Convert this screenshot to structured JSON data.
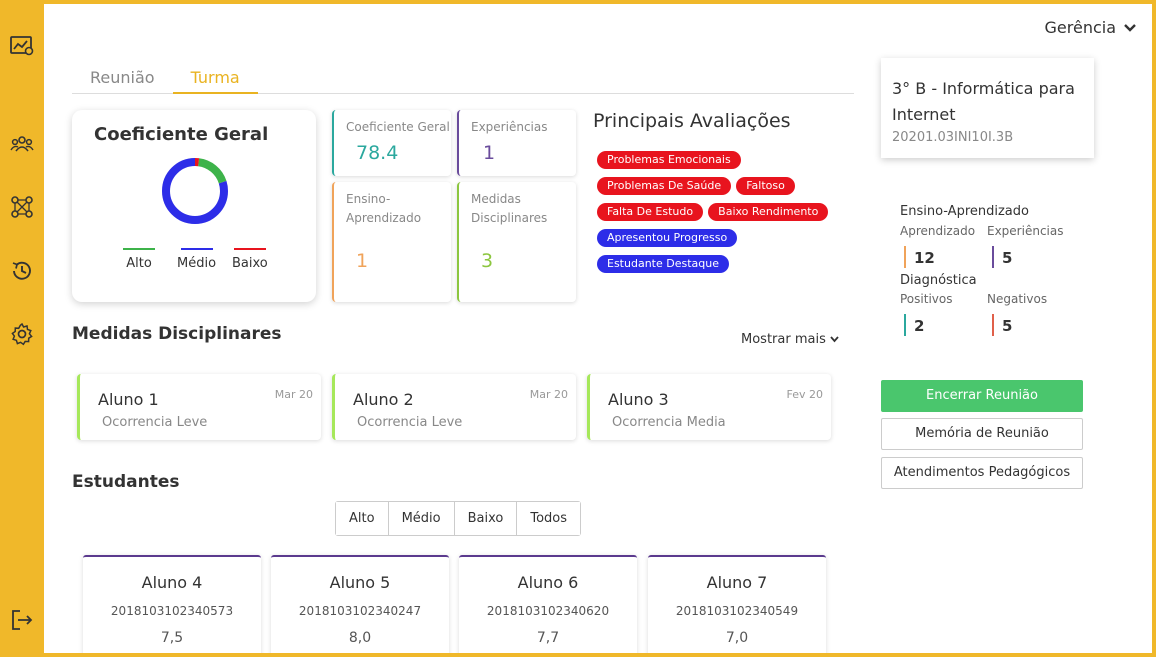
{
  "header": {
    "user_menu_label": "Gerência"
  },
  "tabs": [
    {
      "label": "Reunião",
      "active": false
    },
    {
      "label": "Turma",
      "active": true
    }
  ],
  "coeficiente_card": {
    "title": "Coeficiente Geral",
    "donut": {
      "alto": 0.18,
      "medio": 0.8,
      "baixo": 0.02
    },
    "legend": [
      {
        "label": "Alto",
        "color": "#3DB34A"
      },
      {
        "label": "Médio",
        "color": "#2D2DE8"
      },
      {
        "label": "Baixo",
        "color": "#E8141E"
      }
    ]
  },
  "metrics": {
    "coeficiente": {
      "label": "Coeficiente Geral",
      "value": "78.4",
      "color": "#2BA89E"
    },
    "experiencias": {
      "label": "Experiências",
      "value": "1",
      "color": "#6A4C9C"
    },
    "ensino": {
      "label": "Ensino-Aprendizado",
      "value": "1",
      "color": "#F0A35A"
    },
    "medidas": {
      "label": "Medidas Disciplinares",
      "value": "3",
      "color": "#8CC63F"
    }
  },
  "avaliacoes": {
    "title": "Principais Avaliações",
    "tags": [
      {
        "label": "Problemas Emocionais",
        "kind": "red"
      },
      {
        "label": "Problemas De Saúde",
        "kind": "red"
      },
      {
        "label": "Faltoso",
        "kind": "red"
      },
      {
        "label": "Falta De Estudo",
        "kind": "red"
      },
      {
        "label": "Baixo Rendimento",
        "kind": "red"
      },
      {
        "label": "Apresentou Progresso",
        "kind": "blue"
      },
      {
        "label": "Estudante Destaque",
        "kind": "blue"
      }
    ]
  },
  "medidas_disciplinares": {
    "title": "Medidas Disciplinares",
    "show_more": "Mostrar mais",
    "items": [
      {
        "name": "Aluno 1",
        "date": "Mar 20",
        "occurrence": "Ocorrencia Leve"
      },
      {
        "name": "Aluno 2",
        "date": "Mar 20",
        "occurrence": "Ocorrencia Leve"
      },
      {
        "name": "Aluno 3",
        "date": "Fev 20",
        "occurrence": "Ocorrencia Media"
      }
    ]
  },
  "estudantes": {
    "title": "Estudantes",
    "filters": [
      "Alto",
      "Médio",
      "Baixo",
      "Todos"
    ],
    "items": [
      {
        "name": "Aluno 4",
        "id": "2018103102340573",
        "grade": "7,5"
      },
      {
        "name": "Aluno 5",
        "id": "2018103102340247",
        "grade": "8,0"
      },
      {
        "name": "Aluno 6",
        "id": "2018103102340620",
        "grade": "7,7"
      },
      {
        "name": "Aluno 7",
        "id": "2018103102340549",
        "grade": "7,0"
      }
    ]
  },
  "turma": {
    "name": "3° B - Informática para Internet",
    "code": "20201.03INI10I.3B"
  },
  "stats": {
    "ensino_head": "Ensino-Aprendizado",
    "aprendizado_label": "Aprendizado",
    "aprendizado_value": "12",
    "experiencias_label": "Experiências",
    "experiencias_value": "5",
    "diagnostica_head": "Diagnóstica",
    "positivos_label": "Positivos",
    "positivos_value": "2",
    "negativos_label": "Negativos",
    "negativos_value": "5"
  },
  "actions": {
    "encerrar": "Encerrar Reunião",
    "memoria": "Memória de Reunião",
    "atendimentos": "Atendimentos Pedagógicos"
  },
  "colors": {
    "accent": "#F0B82A",
    "green_button": "#4AC66D",
    "tag_red": "#E8141E",
    "tag_blue": "#2D2DE8"
  }
}
